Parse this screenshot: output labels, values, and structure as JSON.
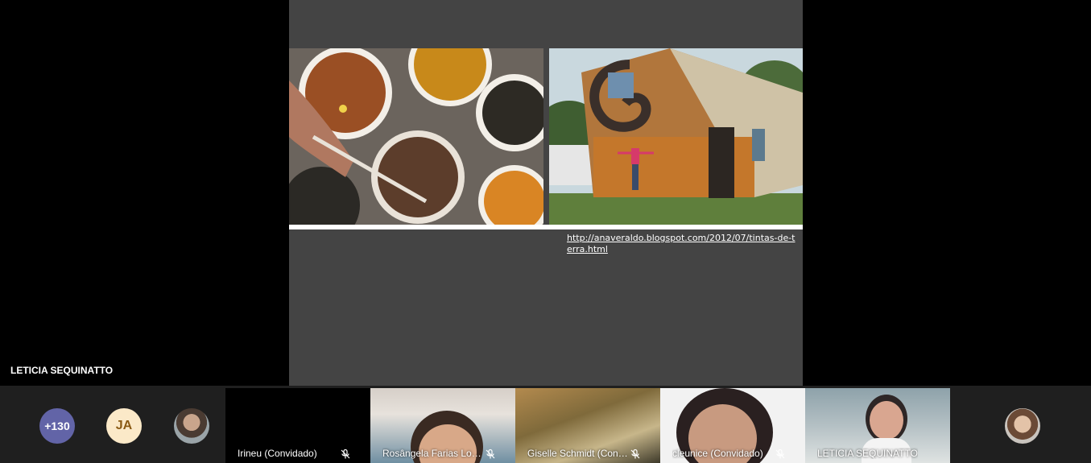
{
  "slide": {
    "link_text": "http://anaveraldo.blogspot.com/2012/07/tintas-de-terra.html"
  },
  "stage": {
    "speaker_name": "LETICIA SEQUINATTO"
  },
  "bottom_bar": {
    "overflow_count": "+130",
    "initials": "JA",
    "participants": [
      {
        "label": "Irineu (Convidado)",
        "muted": true
      },
      {
        "label": "Rosângela Farias Lope...",
        "muted": true
      },
      {
        "label": "Giselle Schmidt (Convi...",
        "muted": true
      },
      {
        "label": "cleunice (Convidado)",
        "muted": true
      },
      {
        "label": "LETICIA SEQUINATTO",
        "muted": false
      }
    ]
  },
  "icons": {
    "mic_off": "microphone-off-icon"
  },
  "colors": {
    "overflow_badge": "#6264a7",
    "initials_bg": "#fbe9c8",
    "slide_bg": "#444444",
    "bar_bg": "#1f1f1f"
  }
}
